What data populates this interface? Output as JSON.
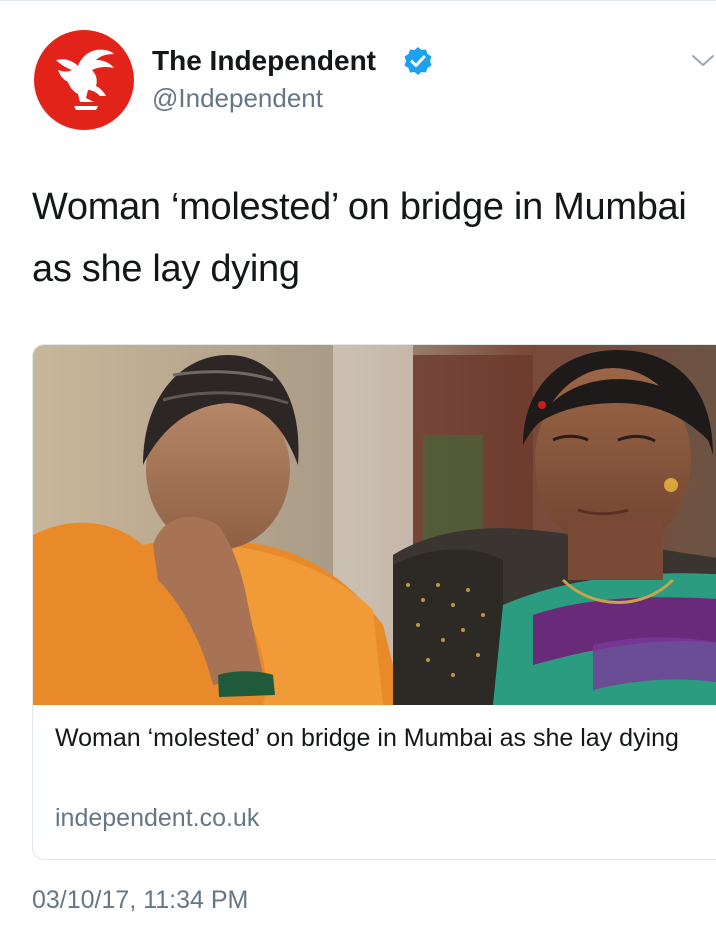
{
  "account": {
    "name": "The Independent",
    "handle": "@Independent",
    "verified": true,
    "avatar_icon": "eagle-logo-icon",
    "brand_color": "#e2231a"
  },
  "tweet": {
    "text": "Woman ‘molested’ on bridge in Mumbai as she lay dying",
    "timestamp": "03/10/17, 11:34 PM"
  },
  "card": {
    "image_icon": "news-photo",
    "title": "Woman ‘molested’ on bridge in Mumbai as she lay dying",
    "domain": "independent.co.uk"
  },
  "icons": {
    "verified": "verified-badge-icon",
    "menu": "chevron-down-icon"
  },
  "colors": {
    "text_primary": "#14171a",
    "text_secondary": "#657786",
    "verified_blue": "#1da1f2",
    "border": "#e1e8ed"
  }
}
